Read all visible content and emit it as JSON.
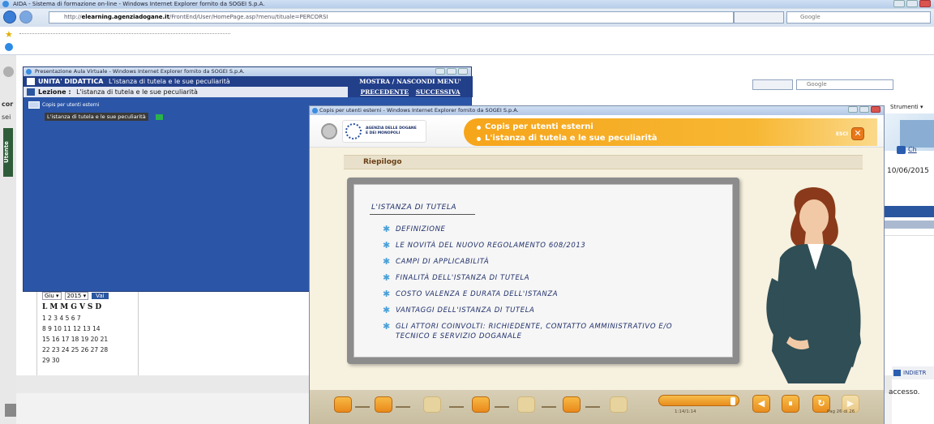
{
  "ie": {
    "title": "AIDA - Sistema di formazione on-line - Windows Internet Explorer fornito da SOGEI S.p.A.",
    "url_prefix": "http://",
    "url_domain": "elearning.agenziadogane.it",
    "url_rest": "/FrontEnd/User/HomePage.asp?menu/tituale=PERCORSI",
    "search_placeholder": "Google"
  },
  "page": {
    "cor_label": "cor",
    "sei_label": "sei",
    "utente_label": "Utente",
    "strumenti": "Strumenti",
    "chiudi": "Ch",
    "date": "10/06/2015",
    "indietro": "INDIETR",
    "accesso": "accesso.",
    "search_placeholder": "Google"
  },
  "calendar": {
    "month": "Giu",
    "year": "2015",
    "go": "Vai",
    "days": "LMMGVSD",
    "weeks": [
      "1 2 3 4 5 6 7",
      "8 9 10 11 12 13 14",
      "15 16 17 18 19 20 21",
      "22 23 24 25 26 27 28",
      "29 30"
    ]
  },
  "aula": {
    "title": "Presentazione Aula Virtuale - Windows Internet Explorer fornito da SOGEI S.p.A.",
    "ud_label": "UNITA' DIDATTICA",
    "ud_value": "L'istanza di tutela e le sue peculiarità",
    "lezione_label": "Lezione :",
    "lezione_value": "L'istanza di tutela e le sue peculiarità",
    "mostra": "MOSTRA / NASCONDI MENU'",
    "precedente": "PRECEDENTE",
    "successiva": "SUCCESSIVA",
    "tree_root": "Copis per utenti esterni",
    "tree_item": "L'istanza di tutela e le sue peculiarità"
  },
  "copis": {
    "title": "Copis per utenti esterni - Windows Internet Explorer fornito da SOGEI S.p.A.",
    "agency_line1": "AGENZIA DELLE DOGANE",
    "agency_line2": "E DEI MONOPOLI",
    "header_line1": "Copis per utenti esterni",
    "header_line2": "L'istanza di tutela e le sue peculiarità",
    "esci": "ESCI",
    "section": "Riepilogo",
    "board_title": "L'ISTANZA DI TUTELA",
    "items": [
      "DEFINIZIONE",
      "LE NOVITÀ DEL NUOVO REGOLAMENTO 608/2013",
      "CAMPI DI APPLICABILITÀ",
      "FINALITÀ DELL'ISTANZA DI TUTELA",
      "COSTO VALENZA E DURATA DELL'ISTANZA",
      "VANTAGGI DELL'ISTANZA DI TUTELA",
      "GLI ATTORI COINVOLTI: RICHIEDENTE, CONTATTO AMMINISTRATIVO E/O TECNICO E SERVIZIO DOGANALE"
    ],
    "time": "1:14/1:14",
    "page": "Pag 26 di 26"
  }
}
